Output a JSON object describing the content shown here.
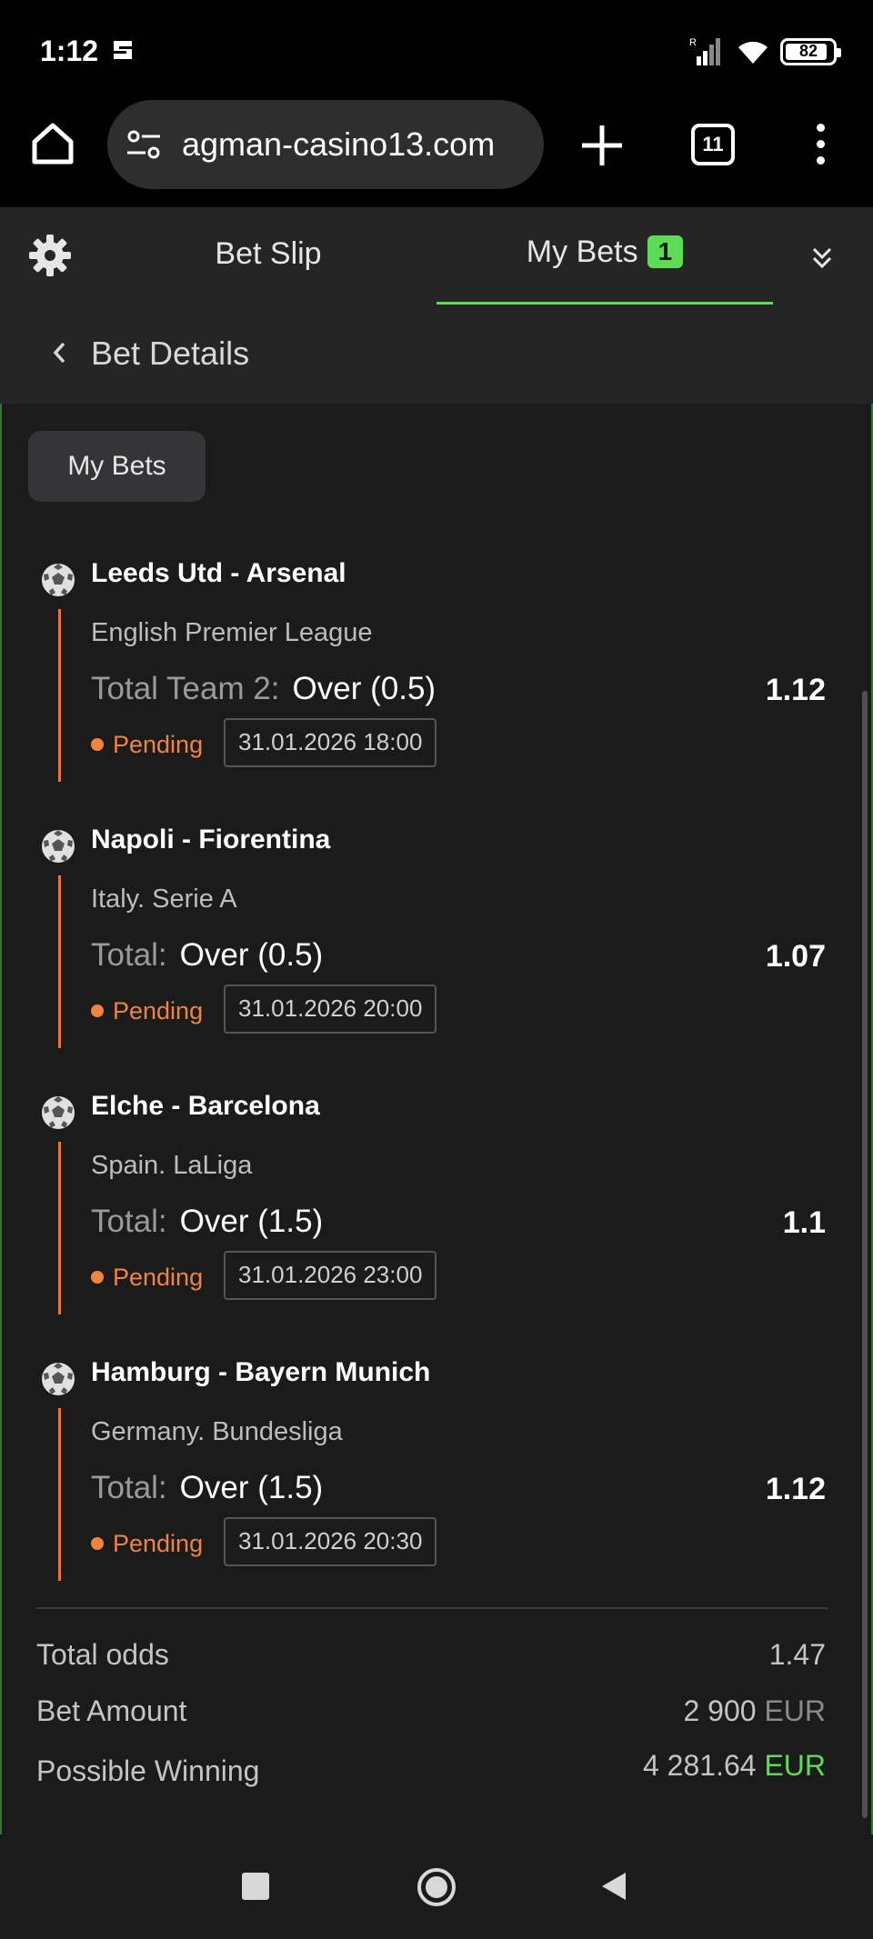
{
  "status_bar": {
    "time": "1:12",
    "battery": "82"
  },
  "browser": {
    "url": "agman-casino13.com",
    "tab_count": "11"
  },
  "top_nav": {
    "bet_slip_label": "Bet Slip",
    "my_bets_label": "My Bets",
    "my_bets_badge": "1"
  },
  "details": {
    "title": "Bet Details",
    "filter_button": "My Bets"
  },
  "bets": [
    {
      "match": "Leeds Utd - Arsenal",
      "league": "English Premier League",
      "market": "Total Team 2:",
      "selection": "Over (0.5)",
      "odds": "1.12",
      "status": "Pending",
      "datetime": "31.01.2026 18:00"
    },
    {
      "match": "Napoli - Fiorentina",
      "league": "Italy. Serie A",
      "market": "Total:",
      "selection": "Over (0.5)",
      "odds": "1.07",
      "status": "Pending",
      "datetime": "31.01.2026 20:00"
    },
    {
      "match": "Elche - Barcelona",
      "league": "Spain. LaLiga",
      "market": "Total:",
      "selection": "Over (1.5)",
      "odds": "1.1",
      "status": "Pending",
      "datetime": "31.01.2026 23:00"
    },
    {
      "match": "Hamburg - Bayern Munich",
      "league": "Germany. Bundesliga",
      "market": "Total:",
      "selection": "Over (1.5)",
      "odds": "1.12",
      "status": "Pending",
      "datetime": "31.01.2026 20:30"
    }
  ],
  "summary": {
    "total_odds_label": "Total odds",
    "total_odds_value": "1.47",
    "bet_amount_label": "Bet Amount",
    "bet_amount_value": "2 900",
    "bet_amount_currency": "EUR",
    "possible_winning_label": "Possible Winning",
    "possible_winning_value": "4 281.64",
    "possible_winning_currency": "EUR"
  },
  "colors": {
    "accent_green": "#5fdc55",
    "pending_orange": "#f0843f"
  }
}
